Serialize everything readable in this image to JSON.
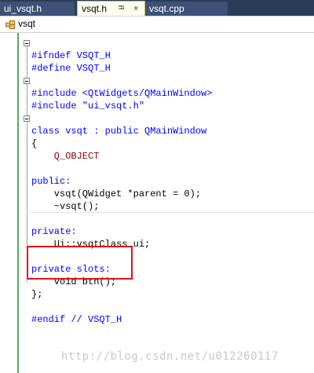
{
  "tabs": [
    {
      "label": "ui_vsqt.h",
      "active": false
    },
    {
      "label": "vsqt.h",
      "active": true,
      "pin": "⭾",
      "close": "×"
    },
    {
      "label": "vsqt.cpp",
      "active": false
    }
  ],
  "nav": {
    "label": "vsqt",
    "icon": "class-icon"
  },
  "code": [
    "#ifndef VSQT_H",
    "#define VSQT_H",
    "",
    "#include <QtWidgets/QMainWindow>",
    "#include \"ui_vsqt.h\"",
    "",
    "class vsqt : public QMainWindow",
    "{",
    "    Q_OBJECT",
    "",
    "public:",
    "    vsqt(QWidget *parent = 0);",
    "    ~vsqt();",
    "",
    "private:",
    "    Ui::vsqtClass ui;",
    "",
    "private slots:",
    "    void btn();",
    "};",
    "",
    "#endif // VSQT_H"
  ],
  "watermark": "http://blog.csdn.net/u012260117",
  "colors": {
    "tabbar": "#2b3c57",
    "highlight": "#e0141e",
    "keyword": "#0000ff",
    "type": "#2b91af",
    "comment": "#008000",
    "macro": "#800000"
  }
}
